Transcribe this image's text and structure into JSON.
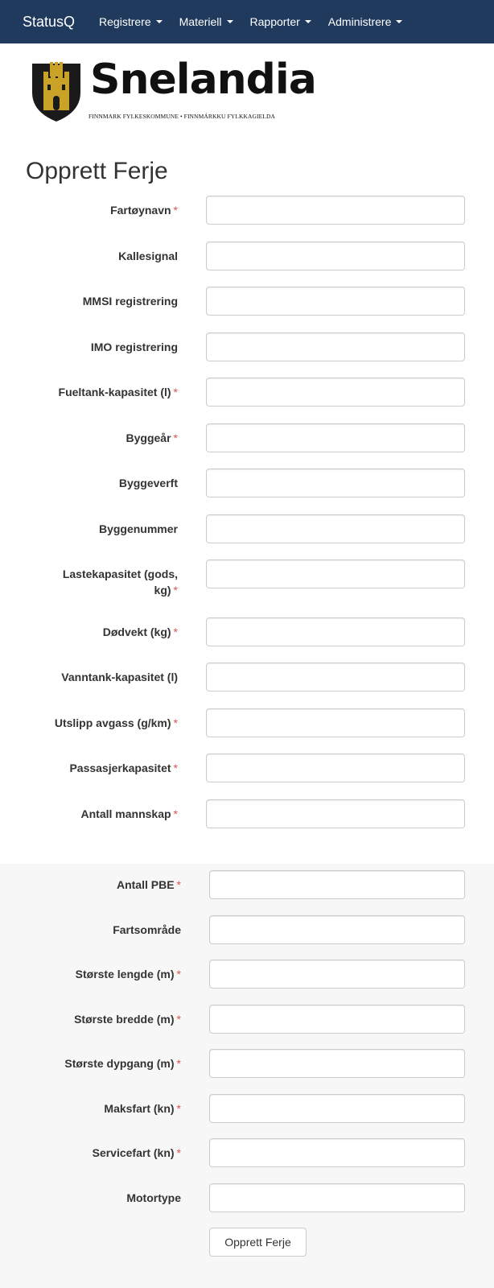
{
  "navbar": {
    "brand": "StatusQ",
    "items": [
      {
        "label": "Registrere"
      },
      {
        "label": "Materiell"
      },
      {
        "label": "Rapporter"
      },
      {
        "label": "Administrere"
      }
    ]
  },
  "logo": {
    "title": "Snelandia",
    "subtitle": "FINNMARK FYLKESKOMMUNE • FINNMÁRKKU FYLKKAGIELDA",
    "colors": {
      "shield": "#1a1a1a",
      "tower": "#c9a227"
    }
  },
  "page": {
    "title": "Opprett Ferje"
  },
  "required_marker": "*",
  "form": {
    "fields": [
      {
        "label": "Fartøynavn",
        "required": "*",
        "value": ""
      },
      {
        "label": "Kallesignal",
        "required": "",
        "value": ""
      },
      {
        "label": "MMSI registrering",
        "required": "",
        "value": ""
      },
      {
        "label": "IMO registrering",
        "required": "",
        "value": ""
      },
      {
        "label": "Fueltank-kapasitet (l)",
        "required": "*",
        "value": ""
      },
      {
        "label": "Byggeår",
        "required": "*",
        "value": ""
      },
      {
        "label": "Byggeverft",
        "required": "",
        "value": ""
      },
      {
        "label": "Byggenummer",
        "required": "",
        "value": ""
      },
      {
        "label": "Lastekapasitet (gods,",
        "label2": "kg)",
        "required": "*",
        "value": ""
      },
      {
        "label": "Dødvekt (kg)",
        "required": "*",
        "value": ""
      },
      {
        "label": "Vanntank-kapasitet (l)",
        "required": "",
        "value": ""
      },
      {
        "label": "Utslipp avgass (g/km)",
        "required": "*",
        "value": ""
      },
      {
        "label": "Passasjerkapasitet",
        "required": "*",
        "value": ""
      },
      {
        "label": "Antall mannskap",
        "required": "*",
        "value": ""
      }
    ],
    "section2_fields": [
      {
        "label": "Antall PBE",
        "required": "*",
        "value": ""
      },
      {
        "label": "Fartsområde",
        "required": "",
        "value": ""
      },
      {
        "label": "Største lengde (m)",
        "required": "*",
        "value": ""
      },
      {
        "label": "Største bredde (m)",
        "required": "*",
        "value": ""
      },
      {
        "label": "Største dypgang (m)",
        "required": "*",
        "value": ""
      },
      {
        "label": "Maksfart (kn)",
        "required": "*",
        "value": ""
      },
      {
        "label": "Servicefart (kn)",
        "required": "*",
        "value": ""
      },
      {
        "label": "Motortype",
        "required": "",
        "value": ""
      }
    ],
    "submit_label": "Opprett Ferje"
  },
  "colors": {
    "navbar_bg": "#1f3a5c",
    "required": "#d9534f",
    "section2_bg": "#f7f7f7"
  }
}
